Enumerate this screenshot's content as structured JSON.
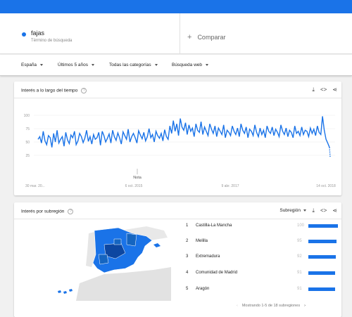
{
  "term": {
    "name": "fajas",
    "subtitle": "Término de búsqueda",
    "color": "#1a73e8"
  },
  "compare": {
    "label": "Comparar"
  },
  "filters": [
    {
      "label": "España"
    },
    {
      "label": "Últimos 5 años"
    },
    {
      "label": "Todas las categorías"
    },
    {
      "label": "Búsqueda web"
    }
  ],
  "interest_time": {
    "title": "Interés a lo largo del tiempo",
    "note_label": "Nota"
  },
  "interest_region": {
    "title": "Interés por subregión",
    "selector": "Subregión",
    "pager_text": "Mostrando 1-5 de 18 subregiones",
    "rows": [
      {
        "rank": "1",
        "name": "Castilla-La Mancha",
        "value": 100
      },
      {
        "rank": "2",
        "name": "Melilla",
        "value": 95
      },
      {
        "rank": "3",
        "name": "Extremadura",
        "value": 92
      },
      {
        "rank": "4",
        "name": "Comunidad de Madrid",
        "value": 91
      },
      {
        "rank": "5",
        "name": "Aragón",
        "value": 91
      }
    ]
  },
  "chart_data": {
    "type": "line",
    "y_ticks": [
      "100",
      "75",
      "50",
      "25"
    ],
    "ylim": [
      0,
      100
    ],
    "x_tick_labels": [
      "30 mar. 20...",
      "6 oct. 2015",
      "9 abr. 2017",
      "14 oct. 2018"
    ],
    "series": [
      {
        "color": "#1a73e8",
        "values": [
          55,
          60,
          48,
          70,
          52,
          45,
          62,
          58,
          40,
          66,
          50,
          72,
          48,
          55,
          60,
          42,
          68,
          54,
          47,
          63,
          58,
          70,
          45,
          52,
          66,
          60,
          49,
          57,
          72,
          51,
          60,
          46,
          64,
          55,
          58,
          68,
          44,
          70,
          62,
          50,
          57,
          65,
          48,
          72,
          60,
          53,
          67,
          58,
          46,
          69,
          62,
          55,
          74,
          50,
          60,
          66,
          58,
          48,
          71,
          63,
          56,
          68,
          52,
          60,
          75,
          58,
          64,
          50,
          70,
          62,
          57,
          66,
          52,
          73,
          60,
          55,
          80,
          66,
          90,
          70,
          84,
          62,
          94,
          78,
          72,
          86,
          64,
          82,
          70,
          76,
          60,
          84,
          72,
          68,
          88,
          64,
          78,
          70,
          62,
          84,
          74,
          66,
          80,
          60,
          76,
          70,
          64,
          82,
          58,
          72,
          68,
          62,
          80,
          70,
          64,
          76,
          60,
          84,
          72,
          66,
          78,
          58,
          74,
          70,
          62,
          82,
          68,
          60,
          76,
          64,
          72,
          58,
          80,
          70,
          66,
          78,
          62,
          74,
          68,
          60,
          82,
          70,
          64,
          76,
          60,
          72,
          68,
          58,
          80,
          66,
          70,
          62,
          78,
          64,
          72,
          70,
          60,
          76,
          66,
          74,
          62,
          80,
          68,
          64,
          98,
          72,
          55,
          48,
          40
        ]
      }
    ]
  }
}
